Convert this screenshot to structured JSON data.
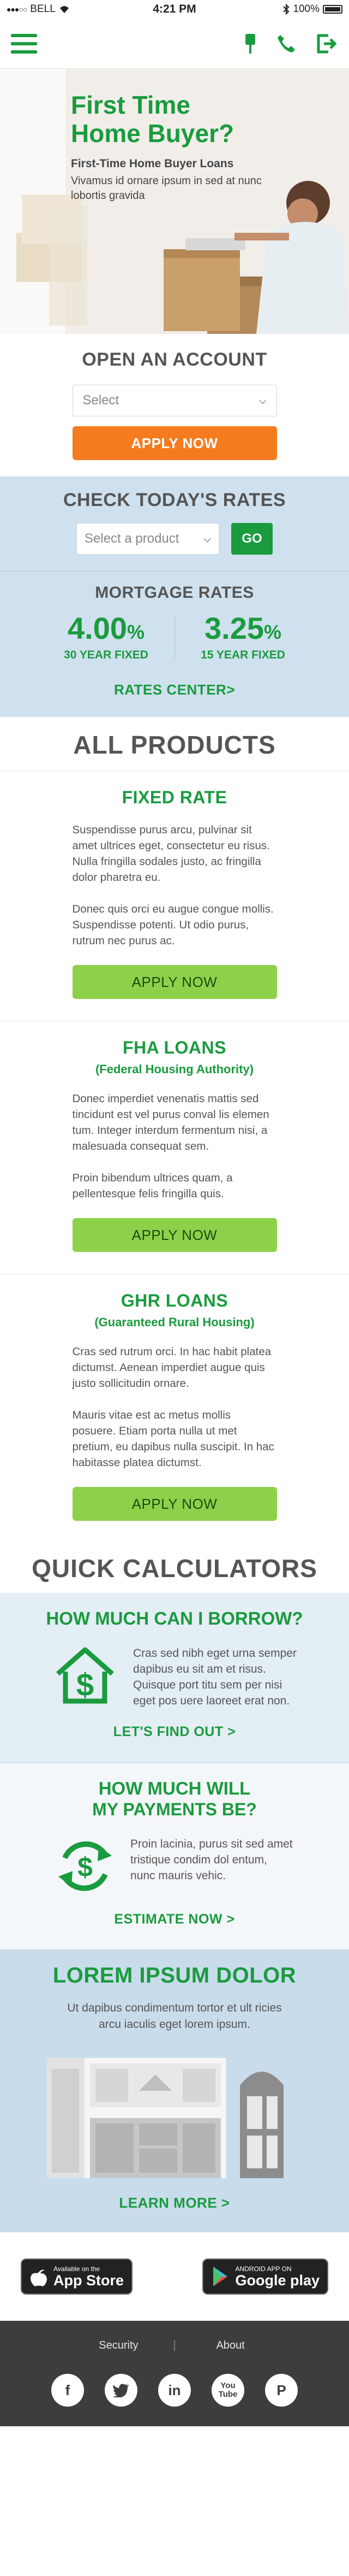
{
  "status_bar": {
    "carrier": "BELL",
    "time": "4:21 PM",
    "battery": "100%"
  },
  "hero": {
    "title_line1": "First Time",
    "title_line2": "Home Buyer?",
    "subtitle": "First-Time Home Buyer Loans",
    "description": "Vivamus id ornare ipsum in sed at nunc lobortis gravida"
  },
  "open_account": {
    "heading": "OPEN AN ACCOUNT",
    "select_value": "Select",
    "button": "APPLY NOW"
  },
  "rates": {
    "heading": "CHECK TODAY'S RATES",
    "select_value": "Select a product",
    "go": "GO",
    "mortgage_heading": "MORTGAGE RATES",
    "items": [
      {
        "value": "4.00",
        "unit": "%",
        "label": "30 YEAR FIXED"
      },
      {
        "value": "3.25",
        "unit": "%",
        "label": "15 YEAR FIXED"
      }
    ],
    "link": "RATES CENTER"
  },
  "products": {
    "heading": "ALL PRODUCTS",
    "items": [
      {
        "title": "FIXED RATE",
        "subtitle": "",
        "para1": "Suspendisse purus arcu, pulvinar sit amet ultrices eget, consectetur eu risus. Nulla fringilla sodales justo, ac fringilla dolor pharetra eu.",
        "para2": "Donec quis orci eu augue congue mollis. Suspendisse potenti. Ut odio purus, rutrum nec purus ac.",
        "button": "APPLY NOW"
      },
      {
        "title": "FHA LOANS",
        "subtitle": "(Federal Housing Authority)",
        "para1": "Donec imperdiet venenatis mattis sed tincidunt est vel purus conval lis elemen tum. Integer interdum fermentum nisi, a malesuada consequat sem.",
        "para2": "Proin bibendum ultrices quam, a pellentesque felis fringilla quis.",
        "button": "APPLY NOW"
      },
      {
        "title": "GHR LOANS",
        "subtitle": "(Guaranteed Rural Housing)",
        "para1": "Cras sed rutrum orci. In hac habit platea dictumst. Aenean imperdiet augue quis justo sollicitudin ornare.",
        "para2": "Mauris vitae est ac metus mollis posuere. Etiam porta nulla ut met pretium, eu dapibus nulla suscipit. In hac habitasse platea dictumst.",
        "button": "APPLY NOW"
      }
    ]
  },
  "calculators": {
    "heading": "QUICK CALCULATORS",
    "borrow": {
      "title": "HOW MUCH CAN I BORROW?",
      "text": "Cras sed nibh eget urna semper dapibus eu sit am et risus. Quisque port titu sem per nisi eget pos uere laoreet erat non.",
      "link": "LET'S FIND OUT"
    },
    "payments": {
      "title_line1": "HOW MUCH WILL",
      "title_line2": "MY PAYMENTS BE?",
      "text": "Proin lacinia, purus sit sed amet tristique condim dol entum, nunc mauris vehic.",
      "link": "ESTIMATE NOW"
    }
  },
  "lorem": {
    "title": "LOREM IPSUM DOLOR",
    "body": "Ut dapibus condimentum tortor et ult ricies arcu iaculis eget lorem ipsum.",
    "link": "LEARN MORE"
  },
  "stores": {
    "apple_small": "Available on the",
    "apple_big": "App Store",
    "google_small": "ANDROID APP ON",
    "google_big": "Google play"
  },
  "footer": {
    "security": "Security",
    "about": "About",
    "separator": "|",
    "socials": [
      "facebook-icon",
      "twitter-icon",
      "linkedin-icon",
      "youtube-icon",
      "pinterest-icon"
    ],
    "facebook_glyph": "f",
    "linkedin_glyph": "in",
    "youtube_glyph": "You Tube",
    "pinterest_glyph": "P"
  },
  "arrow": ">",
  "colors": {
    "brand_green": "#1a9b3e",
    "orange": "#f47c1f",
    "lime": "#8dd14a",
    "rates_bg": "#cfe0ee",
    "footer_bg": "#3d3d3d"
  }
}
